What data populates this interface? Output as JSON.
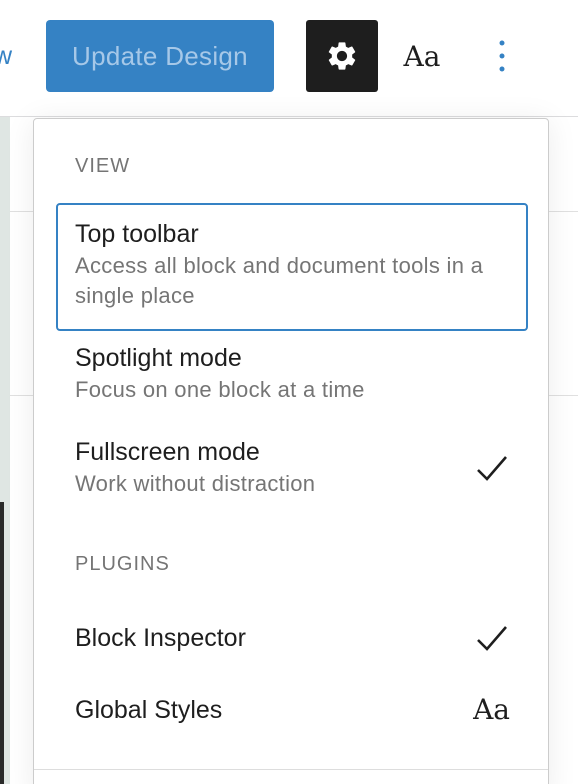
{
  "header": {
    "preview_label": "w",
    "update_button_label": "Update Design",
    "settings_icon": "gear-icon",
    "styles_button_label": "Aa",
    "options_icon": "vertical-ellipsis-icon"
  },
  "menu": {
    "view_group": {
      "label": "VIEW",
      "items": [
        {
          "title": "Top toolbar",
          "description": "Access all block and document tools in a single place",
          "checked": false
        },
        {
          "title": "Spotlight mode",
          "description": "Focus on one block at a time",
          "checked": false
        },
        {
          "title": "Fullscreen mode",
          "description": "Work without distraction",
          "checked": true
        }
      ]
    },
    "plugins_group": {
      "label": "PLUGINS",
      "items": [
        {
          "title": "Block Inspector",
          "checked": true
        },
        {
          "title": "Global Styles",
          "icon_label": "Aa"
        }
      ]
    }
  },
  "colors": {
    "accent": "#3582c4",
    "dark": "#1e1e1e",
    "muted_text": "#757575"
  }
}
